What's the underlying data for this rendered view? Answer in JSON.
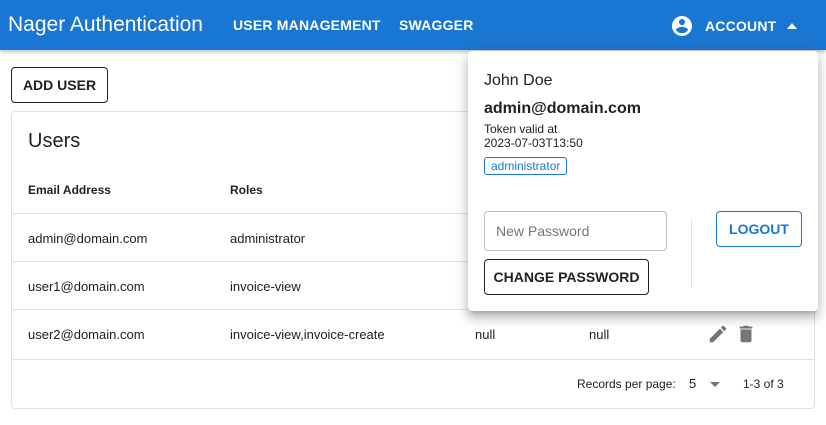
{
  "header": {
    "title": "Nager Authentication",
    "nav": {
      "user_management": "USER MANAGEMENT",
      "swagger": "SWAGGER"
    },
    "account": {
      "label": "ACCOUNT",
      "icon": "account-circle-icon",
      "caret_icon": "caret-up-icon"
    },
    "color": "#1976d2"
  },
  "toolbar": {
    "add_user_label": "ADD USER"
  },
  "users_card": {
    "title": "Users",
    "columns": {
      "email": "Email Address",
      "roles": "Roles"
    },
    "rows": [
      {
        "email": "admin@domain.com",
        "roles": "administrator",
        "col3": "",
        "col4": ""
      },
      {
        "email": "user1@domain.com",
        "roles": "invoice-view",
        "col3": "",
        "col4": ""
      },
      {
        "email": "user2@domain.com",
        "roles": "invoice-view,invoice-create",
        "col3": "null",
        "col4": "null"
      }
    ],
    "footer": {
      "records_per_page_label": "Records per page:",
      "records_per_page_value": "5",
      "range": "1-3 of 3"
    }
  },
  "account_menu": {
    "name": "John Doe",
    "email": "admin@domain.com",
    "token_label": "Token valid at",
    "token_date": "2023-07-03T13:50",
    "role": "administrator",
    "new_password_placeholder": "New Password",
    "change_password_label": "CHANGE PASSWORD",
    "logout_label": "LOGOUT"
  }
}
